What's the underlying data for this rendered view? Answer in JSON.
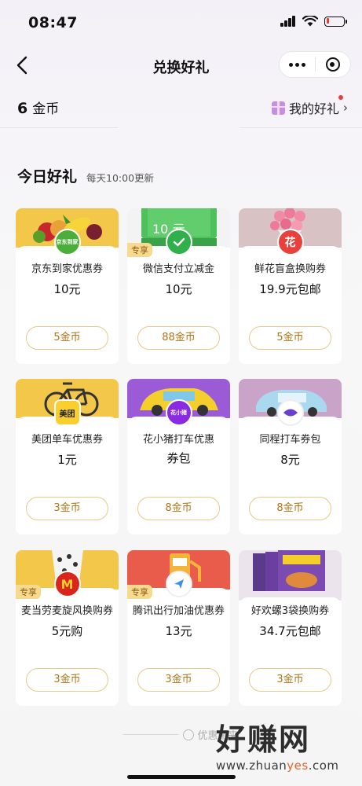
{
  "status_bar": {
    "time": "08:47"
  },
  "nav": {
    "title": "兑换好礼"
  },
  "coins": {
    "count": "6",
    "unit": "金币",
    "my_gifts": "我的好礼"
  },
  "section": {
    "title": "今日好礼",
    "subtitle": "每天10:00更新"
  },
  "colors": {
    "accent": "#b07414",
    "button_border": "#e8c98a",
    "tag_bg": "#f7d98f"
  },
  "cards": [
    {
      "name_line1": "京东到家优惠券",
      "price": "10元",
      "cost": "5金币",
      "tag": "",
      "logo": "京东到家",
      "logo_color": "#4cae3a",
      "banner": "#f3c84a"
    },
    {
      "name_line1": "微信支付立减金",
      "price": "10元",
      "cost": "88金币",
      "tag": "专享",
      "logo": "wechat",
      "logo_color": "#2fb04b",
      "banner": "#4ec05c",
      "banner_text": "10 元"
    },
    {
      "name_line1": "鲜花盲盒换购券",
      "price": "19.9元包邮",
      "cost": "5金币",
      "tag": "",
      "logo": "花",
      "logo_color": "#e8413c",
      "banner": "#d8c2c4"
    },
    {
      "name_line1": "美团单车优惠券",
      "price": "1元",
      "cost": "3金币",
      "tag": "",
      "logo": "美团",
      "logo_color": "#f8cf2d",
      "banner": "#f3c84a"
    },
    {
      "name_line1": "花小猪打车优惠",
      "price": "券包",
      "cost": "8金币",
      "tag": "",
      "logo": "花小猪",
      "logo_color": "#8a2be2",
      "banner": "#9b5bd6"
    },
    {
      "name_line1": "同程打车券包",
      "price": "8元",
      "cost": "8金币",
      "tag": "",
      "logo": "同程",
      "logo_color": "#6a3fd0",
      "banner": "#c9a4c8"
    },
    {
      "name_line1": "麦当劳麦旋风换购券",
      "price": "5元购",
      "cost": "3金币",
      "tag": "专享",
      "logo": "M",
      "logo_color": "#d9251c",
      "banner": "#f3c84a"
    },
    {
      "name_line1": "腾讯出行加油优惠券",
      "price": "13元",
      "cost": "3金币",
      "tag": "专享",
      "logo": "tencent",
      "logo_color": "#3d8ef0",
      "banner": "#e95c4b"
    },
    {
      "name_line1": "好欢螺3袋换购券",
      "price": "34.7元包邮",
      "cost": "3金币",
      "tag": "",
      "logo": "",
      "logo_color": "#6b3fa0",
      "banner": "#ece4ec"
    }
  ],
  "footer": {
    "hint": "优惠带来"
  },
  "watermark": {
    "big": "好赚网",
    "small_a": "www.zhuan",
    "small_b": "yes",
    "small_c": ".com"
  }
}
